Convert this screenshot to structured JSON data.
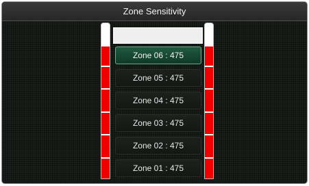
{
  "window": {
    "title": "Zone Sensitivity"
  },
  "colors": {
    "segment": "#ee0000",
    "selected": "#1f5a40",
    "background": "#101410"
  },
  "zones": [
    {
      "label": "Zone 06 : 475",
      "selected": true
    },
    {
      "label": "Zone 05 : 475",
      "selected": false
    },
    {
      "label": "Zone 04 : 475",
      "selected": false
    },
    {
      "label": "Zone 03 : 475",
      "selected": false
    },
    {
      "label": "Zone 02 : 475",
      "selected": false
    },
    {
      "label": "Zone 01 : 475",
      "selected": false
    }
  ],
  "top_field": {
    "value": ""
  }
}
